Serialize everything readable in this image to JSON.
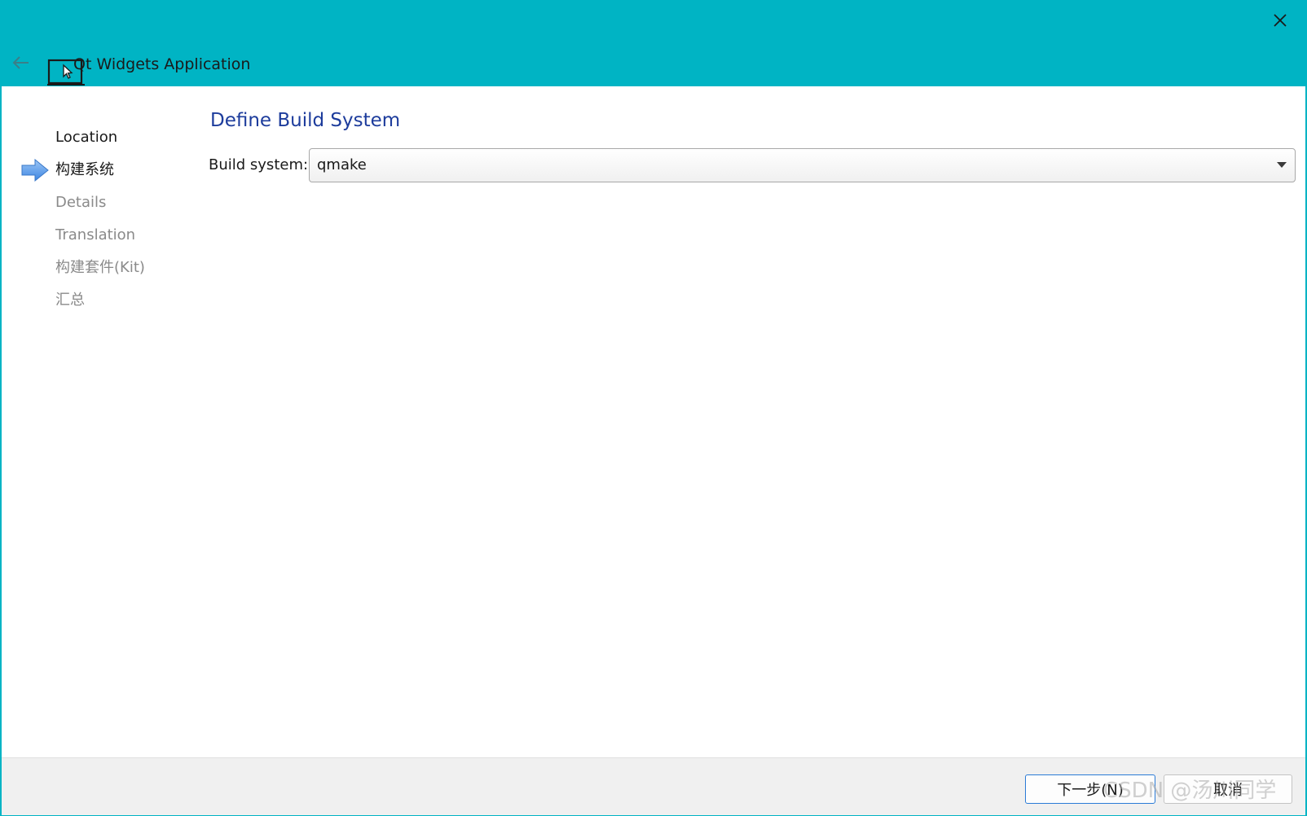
{
  "window": {
    "title": "Qt Widgets Application",
    "accent_color": "#00b4c4"
  },
  "titlebar": {
    "back_icon": "arrow-left-icon",
    "app_icon": "laptop-cursor-icon",
    "close_icon": "close-icon"
  },
  "steps": [
    {
      "label": "Location",
      "state": "done"
    },
    {
      "label": "构建系统",
      "state": "current"
    },
    {
      "label": "Details",
      "state": "pending"
    },
    {
      "label": "Translation",
      "state": "pending"
    },
    {
      "label": "构建套件(Kit)",
      "state": "pending"
    },
    {
      "label": "汇总",
      "state": "pending"
    }
  ],
  "page": {
    "title": "Define Build System",
    "title_color": "#1d3c9c",
    "build_system_label": "Build system:",
    "build_system_value": "qmake"
  },
  "footer": {
    "next_label": "下一步(N)",
    "cancel_label": "取消"
  },
  "watermark": "CSDN @汤川同学"
}
